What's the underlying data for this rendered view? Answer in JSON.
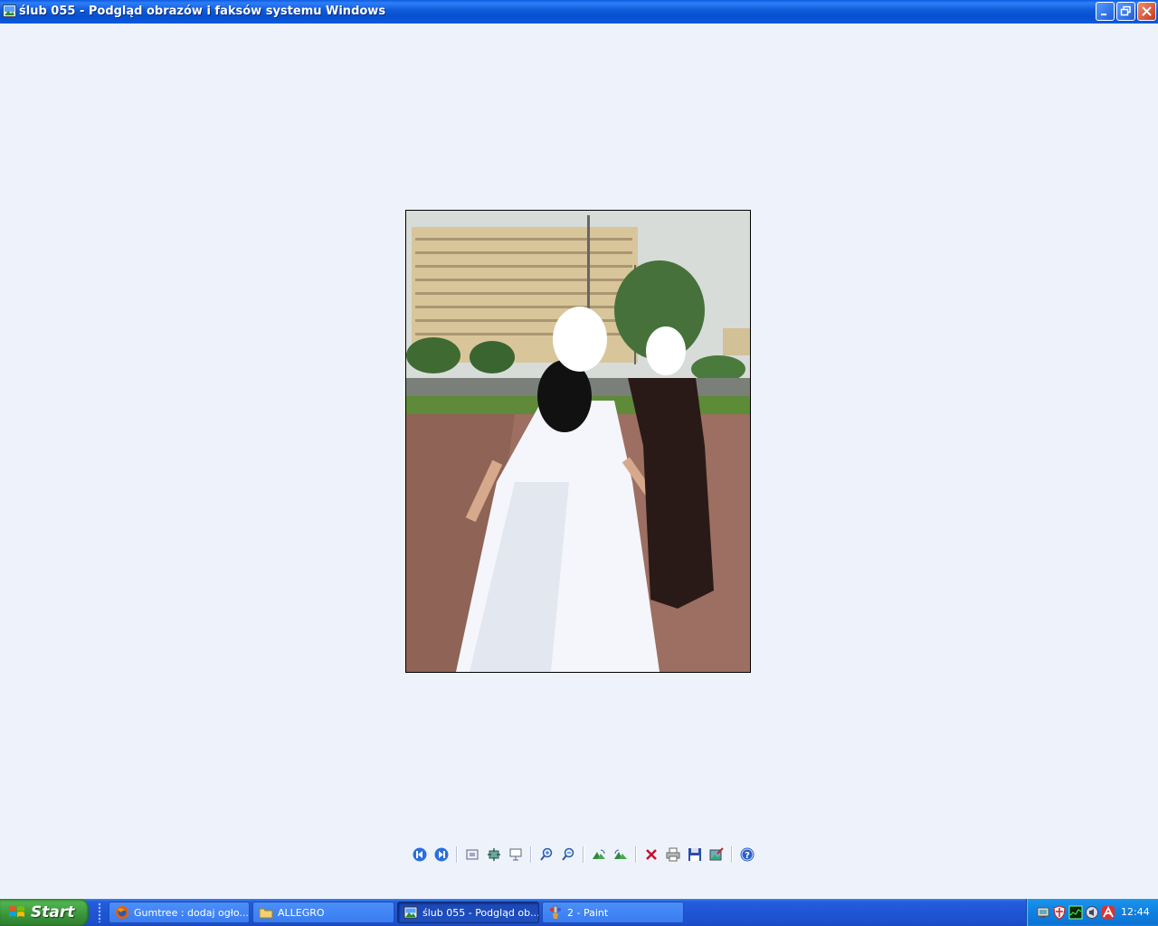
{
  "window": {
    "title": "ślub 055 - Podgląd obrazów i faksów systemu Windows"
  },
  "toolbar": {
    "buttons": [
      "prev-image",
      "next-image",
      "best-fit",
      "actual-size",
      "slideshow",
      "zoom-in",
      "zoom-out",
      "rotate-clockwise",
      "rotate-counterclockwise",
      "delete",
      "print",
      "save",
      "open-for-editing",
      "help"
    ]
  },
  "taskbar": {
    "start_label": "Start",
    "tasks": [
      {
        "label": "Gumtree : dodaj ogło...",
        "icon": "firefox-icon"
      },
      {
        "label": "ALLEGRO",
        "icon": "folder-icon"
      },
      {
        "label": "ślub 055 - Podgląd ob...",
        "icon": "image-viewer-icon",
        "active": true
      },
      {
        "label": "2 - Paint",
        "icon": "paint-icon"
      }
    ],
    "clock": "12:44"
  }
}
